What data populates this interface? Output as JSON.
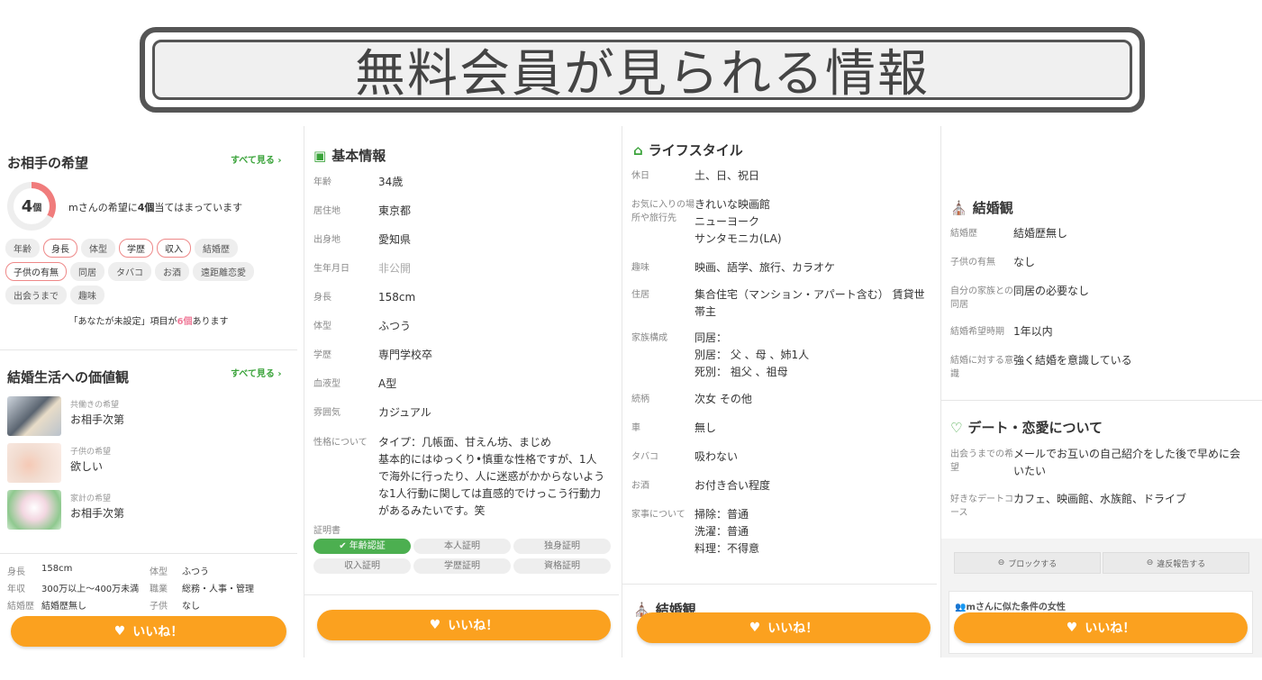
{
  "banner": {
    "title": "無料会員が見られる情報"
  },
  "like_label": "いいね！",
  "panel1": {
    "hope_title": "お相手の希望",
    "see_all": "すべて見る ›",
    "match_count": "4",
    "match_unit": "個",
    "match_text_pre": "mさんの希望に",
    "match_text_num": "4個",
    "match_text_post": "当てはまっています",
    "tags": [
      {
        "label": "年齢",
        "on": false
      },
      {
        "label": "身長",
        "on": true
      },
      {
        "label": "体型",
        "on": false
      },
      {
        "label": "学歴",
        "on": true
      },
      {
        "label": "収入",
        "on": true
      },
      {
        "label": "結婚歴",
        "on": false
      },
      {
        "label": "子供の有無",
        "on": true
      },
      {
        "label": "同居",
        "on": false
      },
      {
        "label": "タバコ",
        "on": false
      },
      {
        "label": "お酒",
        "on": false
      },
      {
        "label": "遠距離恋愛",
        "on": false
      },
      {
        "label": "出会うまで",
        "on": false
      },
      {
        "label": "趣味",
        "on": false
      }
    ],
    "unset_pre": "「あなたが未設定」項目が",
    "unset_num": "6個",
    "unset_post": "あります",
    "values_title": "結婚生活への価値観",
    "values": [
      {
        "sub": "共働きの希望",
        "main": "お相手次第"
      },
      {
        "sub": "子供の希望",
        "main": "欲しい"
      },
      {
        "sub": "家計の希望",
        "main": "お相手次第"
      }
    ],
    "profile": [
      {
        "k1": "身長",
        "v1": "158cm",
        "k2": "体型",
        "v2": "ふつう"
      },
      {
        "k1": "年収",
        "v1": "300万以上〜400万未満",
        "k2": "職業",
        "v2": "総務・人事・管理"
      },
      {
        "k1": "結婚歴",
        "v1": "結婚歴無し",
        "k2": "子供",
        "v2": "なし"
      }
    ]
  },
  "panel2": {
    "title": "基本情報",
    "rows": [
      {
        "k": "年齢",
        "v": "34歳"
      },
      {
        "k": "居住地",
        "v": "東京都"
      },
      {
        "k": "出身地",
        "v": "愛知県"
      },
      {
        "k": "生年月日",
        "v": "非公開"
      },
      {
        "k": "身長",
        "v": "158cm"
      },
      {
        "k": "体型",
        "v": "ふつう"
      },
      {
        "k": "学歴",
        "v": "専門学校卒"
      },
      {
        "k": "血液型",
        "v": "A型"
      },
      {
        "k": "雰囲気",
        "v": "カジュアル"
      }
    ],
    "personality_key": "性格について",
    "personality": "タイプ：几帳面、甘えん坊、まじめ\n基本的にはゆっくり•慎重な性格ですが、1人で海外に行ったり、人に迷惑がかからないような1人行動に関しては直感的でけっこう行動力があるみたいです。笑",
    "cert_label": "証明書",
    "certs": [
      "年齢認証",
      "本人証明",
      "独身証明",
      "収入証明",
      "学歴証明",
      "資格証明"
    ]
  },
  "panel3": {
    "title": "ライフスタイル",
    "rows": [
      {
        "k": "休日",
        "v": "土、日、祝日"
      },
      {
        "k": "お気に入りの場所や旅行先",
        "v": "きれいな映画館\nニューヨーク\nサンタモニカ(LA)"
      },
      {
        "k": "趣味",
        "v": "映画、語学、旅行、カラオケ"
      },
      {
        "k": "住居",
        "v": "集合住宅（マンション・アパート含む） 賃貸世帯主"
      },
      {
        "k": "家族構成",
        "v": "同居：\n別居： 父 、母 、姉1人\n死別： 祖父 、祖母"
      },
      {
        "k": "続柄",
        "v": "次女 その他"
      },
      {
        "k": "車",
        "v": "無し"
      },
      {
        "k": "タバコ",
        "v": "吸わない"
      },
      {
        "k": "お酒",
        "v": "お付き合い程度"
      },
      {
        "k": "家事について",
        "v": "掃除：普通\n洗濯：普通\n料理：不得意"
      }
    ],
    "next_title": "結婚観"
  },
  "panel4": {
    "marriage_title": "結婚観",
    "marriage_rows": [
      {
        "k": "結婚歴",
        "v": "結婚歴無し"
      },
      {
        "k": "子供の有無",
        "v": "なし"
      },
      {
        "k": "自分の家族との同居",
        "v": "同居の必要なし"
      },
      {
        "k": "結婚希望時期",
        "v": "1年以内"
      },
      {
        "k": "結婚に対する意識",
        "v": "強く結婚を意識している"
      }
    ],
    "date_title": "デート・恋愛について",
    "date_rows": [
      {
        "k": "出会うまでの希望",
        "v": "メールでお互いの自己紹介をした後で早めに会いたい"
      },
      {
        "k": "好きなデートコース",
        "v": "カフェ、映画館、水族館、ドライブ"
      }
    ],
    "block_label": "ブロックする",
    "report_label": "違反報告する",
    "similar_title": "mさんに似た条件の女性"
  }
}
